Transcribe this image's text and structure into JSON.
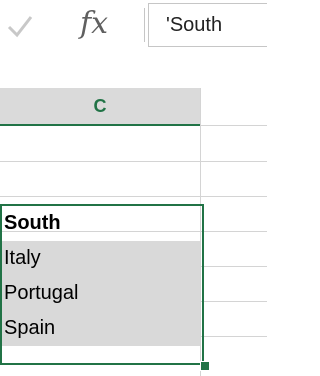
{
  "formula_bar": {
    "enter_icon": "checkmark-icon",
    "fx_icon": "fx-icon",
    "fx_label": "fx",
    "value": "'South"
  },
  "sheet": {
    "column_header": "C",
    "rows": [
      {
        "value": ""
      },
      {
        "value": ""
      },
      {
        "value": "South",
        "bold": true
      },
      {
        "value": "Italy"
      },
      {
        "value": "Portugal"
      },
      {
        "value": "Spain"
      }
    ]
  },
  "colors": {
    "accent": "#217346",
    "selection_fill": "#d9d9d9",
    "header_fill": "#dadada"
  }
}
